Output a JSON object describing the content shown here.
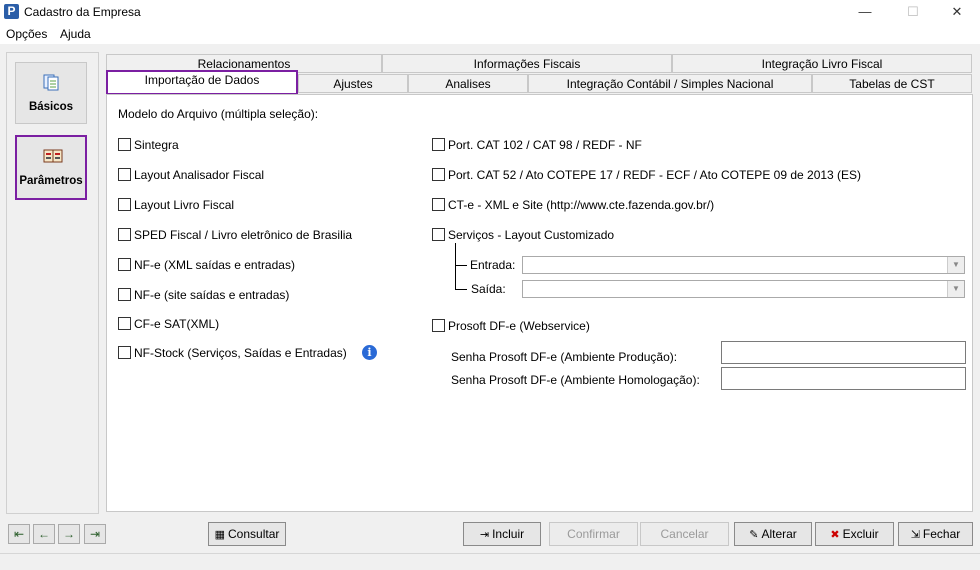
{
  "window": {
    "title": "Cadastro da Empresa",
    "app_icon": "P",
    "minimize": "—",
    "maximize": "☐",
    "close": "✕"
  },
  "menu": [
    "Opções",
    "Ajuda"
  ],
  "sidebar": {
    "items": [
      {
        "label": "Básicos",
        "icon": "documents-icon"
      },
      {
        "label": "Parâmetros",
        "icon": "settings-book-icon",
        "selected": true
      }
    ]
  },
  "tabs": {
    "row1": [
      "Relacionamentos",
      "Informações Fiscais",
      "Integração Livro Fiscal"
    ],
    "row2": [
      "Importação de Dados",
      "Ajustes",
      "Analises",
      "Integração Contábil / Simples Nacional",
      "Tabelas de CST"
    ],
    "active": "Importação de Dados"
  },
  "content": {
    "heading": "Modelo do Arquivo (múltipla seleção):",
    "left_options": [
      "Sintegra",
      "Layout Analisador Fiscal",
      "Layout Livro Fiscal",
      "SPED Fiscal / Livro eletrônico de Brasilia",
      "NF-e (XML saídas e entradas)",
      "NF-e (site saídas e entradas)",
      "CF-e SAT(XML)",
      "NF-Stock (Serviços, Saídas e Entradas)"
    ],
    "right_options": [
      "Port. CAT 102 / CAT 98 / REDF - NF",
      "Port. CAT 52 / Ato COTEPE 17 / REDF - ECF / Ato COTEPE 09 de 2013 (ES)",
      "CT-e - XML e Site (http://www.cte.fazenda.gov.br/)",
      "Serviços - Layout Customizado"
    ],
    "entrada_label": "Entrada:",
    "saida_label": "Saída:",
    "entrada_value": "",
    "saida_value": "",
    "prosoft_label": "Prosoft DF-e (Webservice)",
    "senha_producao_label": "Senha Prosoft DF-e (Ambiente Produção):",
    "senha_homologacao_label": "Senha Prosoft DF-e (Ambiente Homologação):",
    "senha_producao_value": "",
    "senha_homologacao_value": ""
  },
  "toolbar": {
    "consultar": "Consultar",
    "incluir": "Incluir",
    "confirmar": "Confirmar",
    "cancelar": "Cancelar",
    "alterar": "Alterar",
    "excluir": "Excluir",
    "fechar": "Fechar"
  },
  "colors": {
    "highlight": "#7b1fa2",
    "info": "#2a6ad6"
  }
}
